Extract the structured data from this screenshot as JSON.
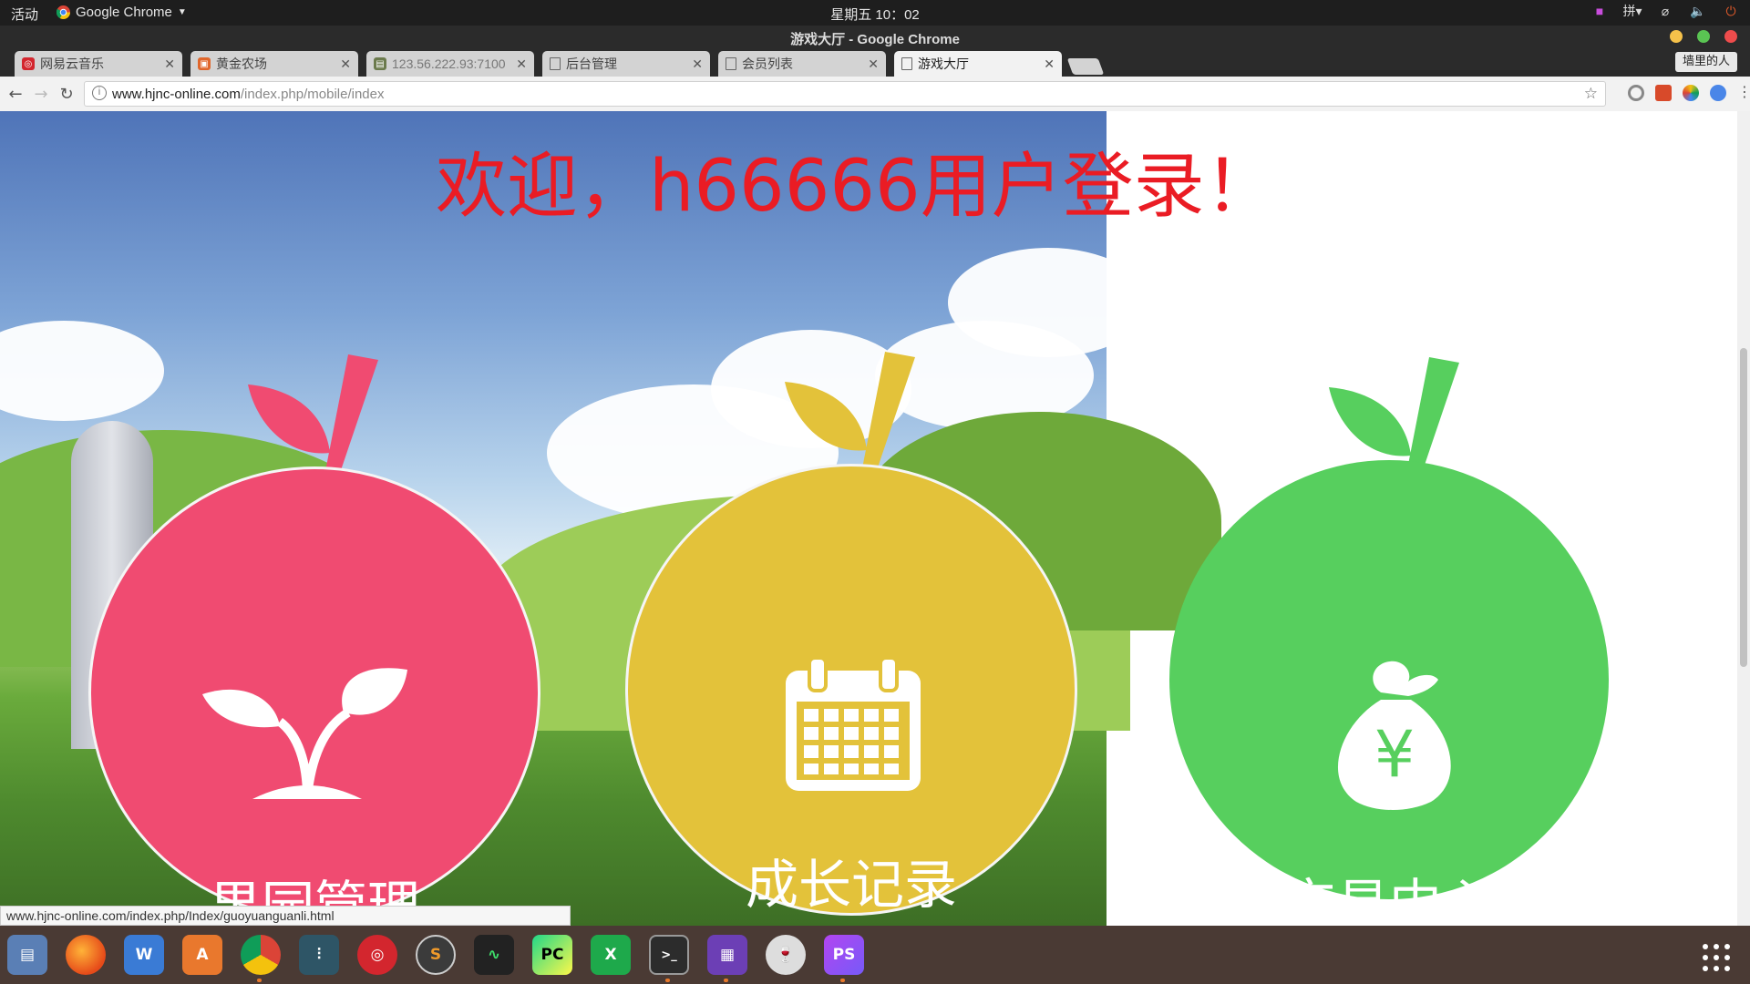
{
  "topbar": {
    "activities": "活动",
    "app_name": "Google Chrome",
    "clock": "星期五 10：02",
    "input_method": "拼"
  },
  "window": {
    "title": "游戏大厅 - Google Chrome",
    "profile": "墙里的人"
  },
  "tabs": [
    {
      "label": "网易云音乐",
      "icon": "netease-music-icon",
      "color": "#d3262e"
    },
    {
      "label": "黄金农场",
      "icon": "farm-icon",
      "color": "#e0662b"
    },
    {
      "label": "123.56.222.93:7100",
      "icon": "image-icon",
      "color": "#6b7a4c"
    },
    {
      "label": "后台管理",
      "icon": "page-icon",
      "color": "#888888"
    },
    {
      "label": "会员列表",
      "icon": "page-icon",
      "color": "#888888"
    },
    {
      "label": "游戏大厅",
      "icon": "page-icon",
      "color": "#888888",
      "active": true
    }
  ],
  "address": {
    "host": "www.hjnc-online.com",
    "path": "/index.php/mobile/index"
  },
  "page": {
    "welcome": "欢迎，h66666用户登录！",
    "cards": [
      {
        "label": "果园管理",
        "icon": "sprout-icon",
        "color": "#f04b71"
      },
      {
        "label": "成长记录",
        "icon": "calendar-icon",
        "color": "#e3c23a"
      },
      {
        "label": "交易中心",
        "icon": "money-bag-icon",
        "color": "#57cf5e"
      }
    ]
  },
  "status_bar": "www.hjnc-online.com/index.php/Index/guoyuanguanli.html",
  "dock": [
    "files-icon",
    "firefox-icon",
    "writer-icon",
    "software-center-icon",
    "chrome-icon",
    "mixer-icon",
    "netease-music-icon",
    "sublime-icon",
    "system-monitor-icon",
    "pycharm-icon",
    "calc-icon",
    "terminal-icon",
    "window-manager-icon",
    "wine-icon",
    "phpstorm-icon"
  ]
}
